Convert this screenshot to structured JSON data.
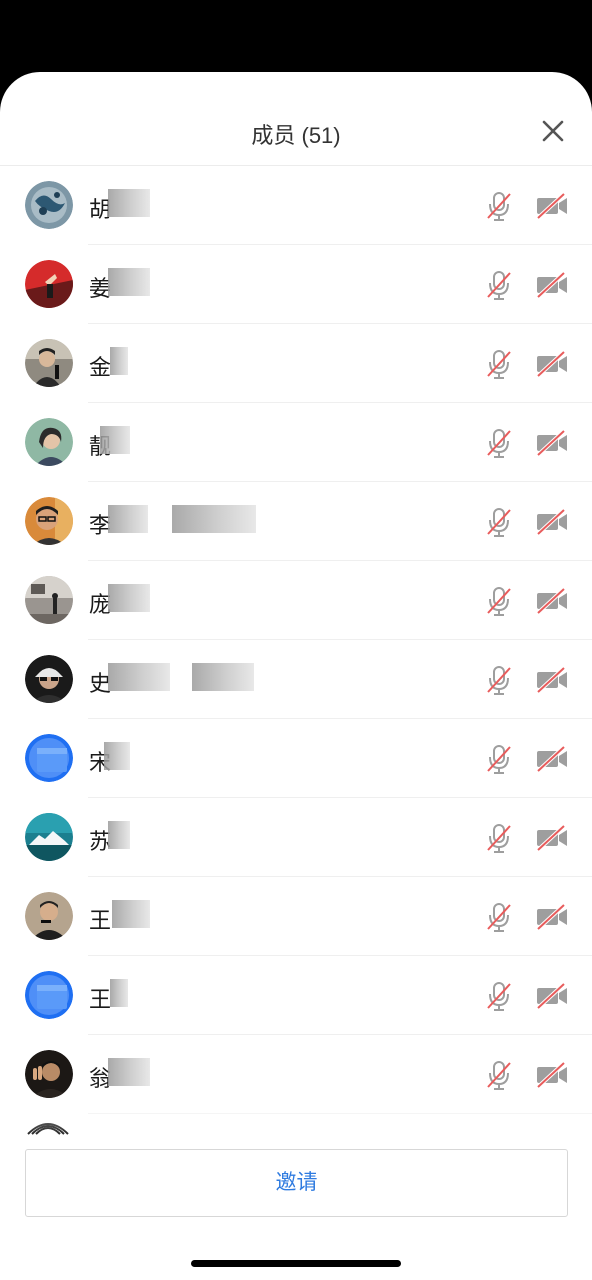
{
  "header": {
    "title": "成员 (51)",
    "close_icon": "close-icon"
  },
  "members": [
    {
      "name": "胡",
      "avatar": "avatar-blue-pattern"
    },
    {
      "name": "姜",
      "avatar": "avatar-red-bridge"
    },
    {
      "name": "金",
      "avatar": "avatar-man-photo"
    },
    {
      "name": "靓",
      "avatar": "avatar-woman-photo"
    },
    {
      "name": "李",
      "avatar": "avatar-man-glasses"
    },
    {
      "name": "庞",
      "avatar": "avatar-grey-scene"
    },
    {
      "name": "史",
      "avatar": "avatar-man-cap"
    },
    {
      "name": "宋",
      "avatar": "avatar-blue-default"
    },
    {
      "name": "苏",
      "avatar": "avatar-iceberg"
    },
    {
      "name": "王",
      "avatar": "avatar-man-mic"
    },
    {
      "name": "王",
      "avatar": "avatar-blue-default"
    },
    {
      "name": "翁",
      "avatar": "avatar-man-peace"
    }
  ],
  "status_icons": {
    "mic": "mic-muted-icon",
    "camera": "camera-off-icon"
  },
  "colors": {
    "accent": "#2f7be0",
    "muted_slash": "#e85c5c",
    "icon_grey": "#9e9e9e"
  },
  "invite": {
    "label": "邀请"
  }
}
